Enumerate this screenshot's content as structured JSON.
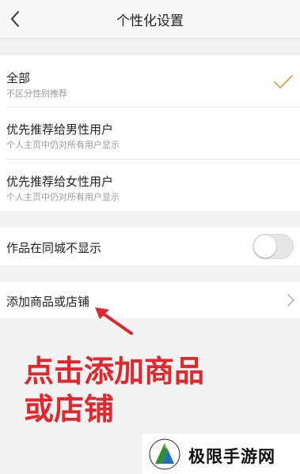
{
  "header": {
    "title": "个性化设置"
  },
  "recommend_options": [
    {
      "title": "全部",
      "subtitle": "不区分性别推荐",
      "selected": true
    },
    {
      "title": "优先推荐给男性用户",
      "subtitle": "个人主页中仍对所有用户显示",
      "selected": false
    },
    {
      "title": "优先推荐给女性用户",
      "subtitle": "个人主页中仍对所有用户显示",
      "selected": false
    }
  ],
  "city_setting": {
    "label": "作品在同城不显示",
    "enabled": false
  },
  "shop_setting": {
    "label": "添加商品或店铺"
  },
  "annotation": {
    "line1": "点击添加商品",
    "line2": "或店铺"
  },
  "watermark": {
    "text": "极限手游网"
  },
  "colors": {
    "accent_check": "#f0a35c",
    "annotation_red": "#e1262c",
    "page_bg": "#f2f2f2"
  }
}
